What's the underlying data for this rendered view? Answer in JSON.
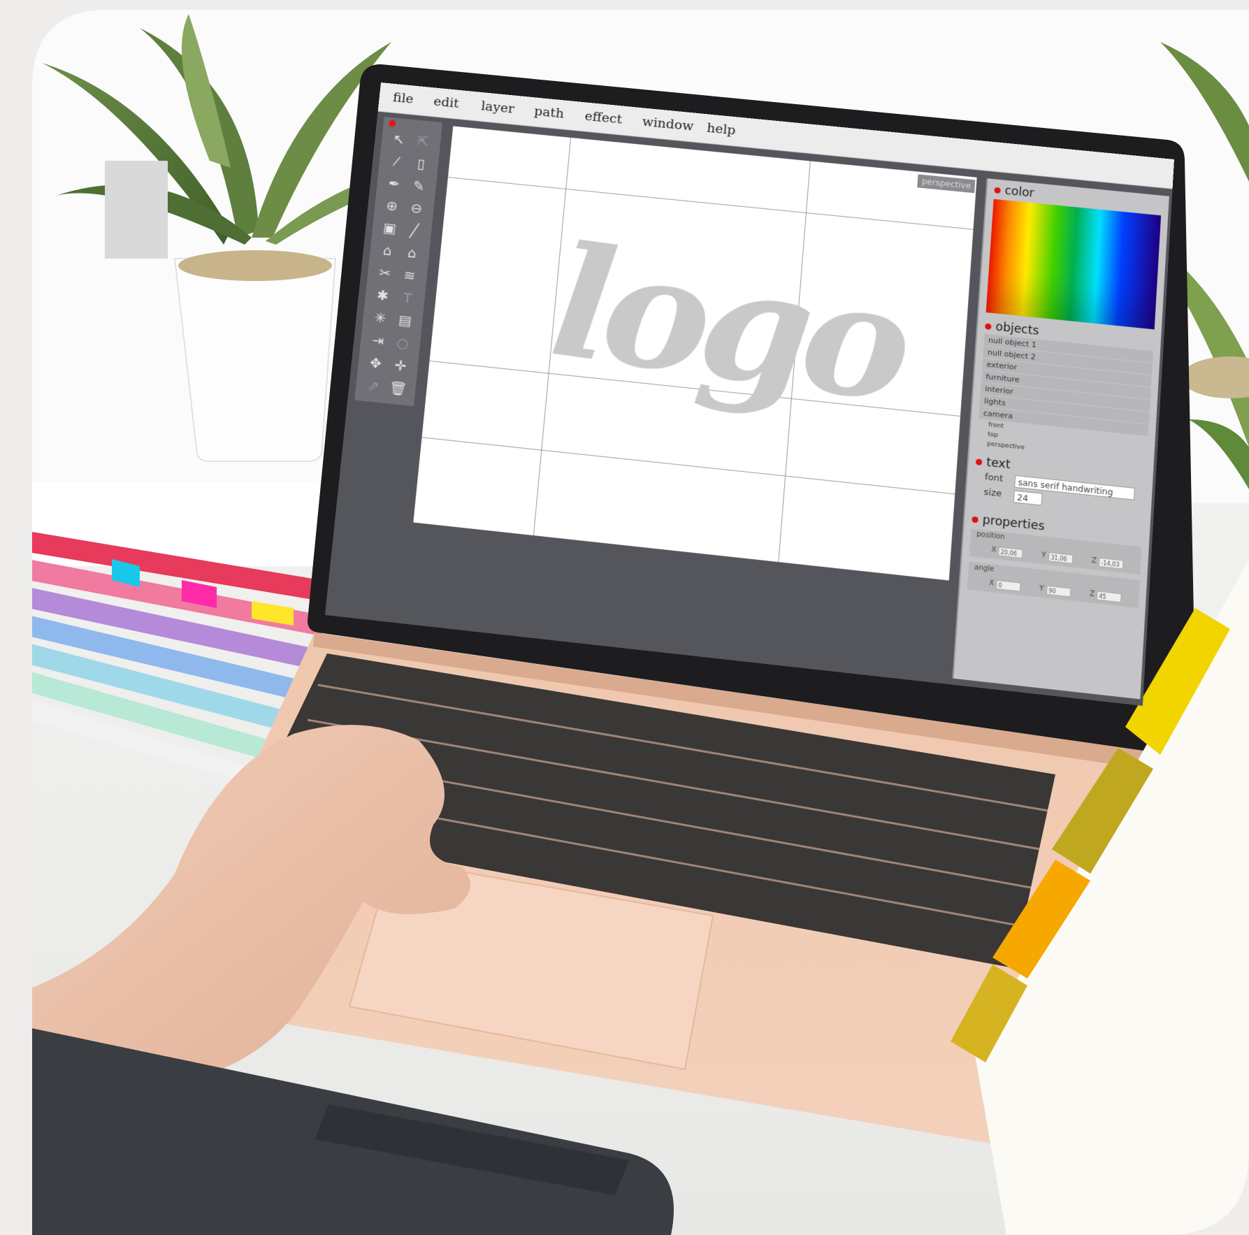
{
  "menu": [
    "file",
    "edit",
    "layer",
    "path",
    "effect",
    "window",
    "help"
  ],
  "toolbar": {
    "icons": [
      "select-arrow-icon",
      "direct-select-icon",
      "brush-icon",
      "page-icon",
      "pen-icon",
      "pencil-icon",
      "zoom-in-icon",
      "zoom-out-icon",
      "lock-icon",
      "line-icon",
      "home-outline-icon",
      "home-filled-icon",
      "scissors-icon",
      "layers-icon",
      "gear-icon",
      "text-icon",
      "sparkle-icon",
      "save-icon",
      "export-icon",
      "rotate-icon",
      "move-icon",
      "crosshair-icon",
      "share-icon",
      "trash-icon"
    ]
  },
  "canvas": {
    "artwork_text": "logo",
    "view_badge": "perspective"
  },
  "panels": {
    "color": {
      "title": "color"
    },
    "objects": {
      "title": "objects",
      "items": [
        "null object 1",
        "null object 2",
        "exterior",
        "furniture",
        "interior",
        "lights",
        "camera"
      ],
      "camera_views": [
        "front",
        "top",
        "perspective"
      ]
    },
    "text": {
      "title": "text",
      "font_label": "font",
      "font_value": "sans serif handwriting",
      "size_label": "size",
      "size_value": "24"
    },
    "properties": {
      "title": "properties",
      "position_label": "position",
      "position": {
        "x": "20,06",
        "y": "31,06",
        "z": "-14,03"
      },
      "angle_label": "angle",
      "angle": {
        "x": "0",
        "y": "90",
        "z": "45"
      },
      "axis_labels": [
        "X",
        "Y",
        "Z"
      ]
    }
  },
  "colors": {
    "accent_dot": "#e01010",
    "screen_bg": "#55565c",
    "laptop_body": "#f3c9ae"
  }
}
